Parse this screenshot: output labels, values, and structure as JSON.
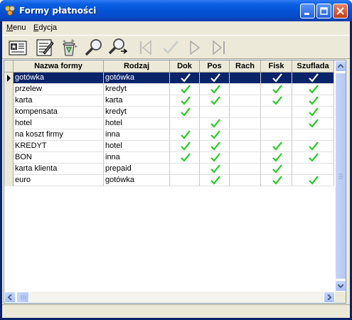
{
  "window": {
    "title": "Formy płatności"
  },
  "menu": [
    {
      "label": "Menu",
      "underline": "M",
      "rest": "enu"
    },
    {
      "label": "Edycja",
      "underline": "E",
      "rest": "dycja"
    }
  ],
  "toolbar": {
    "buttons": [
      "new-record-icon",
      "edit-icon",
      "delete-icon",
      "search-icon",
      "search-next-icon",
      "first-record-icon",
      "check-icon",
      "next-record-icon",
      "last-record-icon"
    ]
  },
  "columns": [
    "Nazwa formy",
    "Rodzaj",
    "Dok",
    "Pos",
    "Rach",
    "Fisk",
    "Szuflada"
  ],
  "rows": [
    {
      "name": "gotówka",
      "type": "gotówka",
      "dok": true,
      "pos": true,
      "rach": false,
      "fisk": true,
      "szuflada": true,
      "selected": true
    },
    {
      "name": "przelew",
      "type": "kredyt",
      "dok": true,
      "pos": true,
      "rach": false,
      "fisk": true,
      "szuflada": true
    },
    {
      "name": "karta",
      "type": "karta",
      "dok": true,
      "pos": true,
      "rach": false,
      "fisk": true,
      "szuflada": true
    },
    {
      "name": "kompensata",
      "type": "kredyt",
      "dok": true,
      "pos": false,
      "rach": false,
      "fisk": false,
      "szuflada": true
    },
    {
      "name": "hotel",
      "type": "hotel",
      "dok": false,
      "pos": true,
      "rach": false,
      "fisk": false,
      "szuflada": true
    },
    {
      "name": "na koszt firmy",
      "type": "inna",
      "dok": true,
      "pos": true,
      "rach": false,
      "fisk": false,
      "szuflada": false
    },
    {
      "name": "KREDYT",
      "type": "hotel",
      "dok": true,
      "pos": true,
      "rach": false,
      "fisk": true,
      "szuflada": true
    },
    {
      "name": "BON",
      "type": "inna",
      "dok": true,
      "pos": true,
      "rach": false,
      "fisk": true,
      "szuflada": true
    },
    {
      "name": "karta klienta",
      "type": "prepaid",
      "dok": false,
      "pos": true,
      "rach": false,
      "fisk": true,
      "szuflada": false
    },
    {
      "name": "euro",
      "type": "gotówka",
      "dok": false,
      "pos": true,
      "rach": false,
      "fisk": true,
      "szuflada": true
    }
  ],
  "colors": {
    "check_green": "#22cc22",
    "check_selected": "#ffffff",
    "selection": "#0a246a"
  }
}
